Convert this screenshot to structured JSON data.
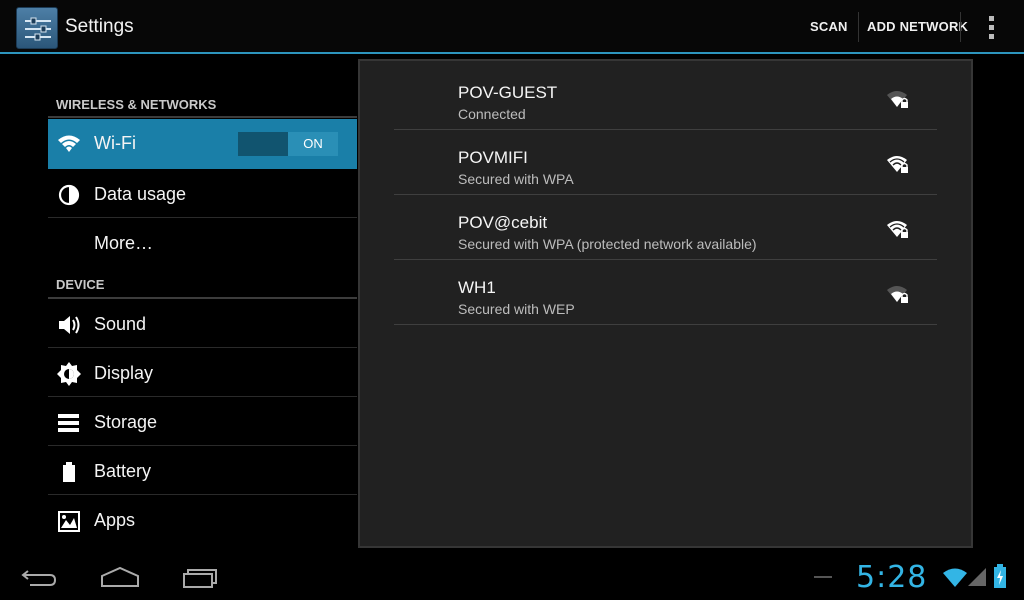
{
  "actionbar": {
    "title": "Settings",
    "scan_label": "SCAN",
    "add_network_label": "ADD NETWORK",
    "accent": "#2d95be"
  },
  "sidebar": {
    "sections": [
      {
        "header": "WIRELESS & NETWORKS",
        "items": [
          {
            "label": "Wi-Fi",
            "icon": "wifi-icon",
            "selected": true,
            "toggle": "ON"
          },
          {
            "label": "Data usage",
            "icon": "data-usage-icon"
          },
          {
            "label": "More…",
            "icon": ""
          }
        ]
      },
      {
        "header": "DEVICE",
        "items": [
          {
            "label": "Sound",
            "icon": "speaker-icon"
          },
          {
            "label": "Display",
            "icon": "brightness-icon"
          },
          {
            "label": "Storage",
            "icon": "storage-icon"
          },
          {
            "label": "Battery",
            "icon": "battery-icon"
          },
          {
            "label": "Apps",
            "icon": "apps-icon"
          }
        ]
      }
    ],
    "selected_color": "#1a7fa8"
  },
  "networks": [
    {
      "ssid": "POV-GUEST",
      "status": "Connected",
      "signal": 0.5,
      "locked": true
    },
    {
      "ssid": "POVMIFI",
      "status": "Secured with WPA",
      "signal": 1.0,
      "locked": true
    },
    {
      "ssid": "POV@cebit",
      "status": "Secured with WPA (protected network available)",
      "signal": 1.0,
      "locked": true
    },
    {
      "ssid": "WH1",
      "status": "Secured with WEP",
      "signal": 0.5,
      "locked": true
    }
  ],
  "statusbar": {
    "time": "5:28",
    "clock_color": "#33b5e5"
  }
}
